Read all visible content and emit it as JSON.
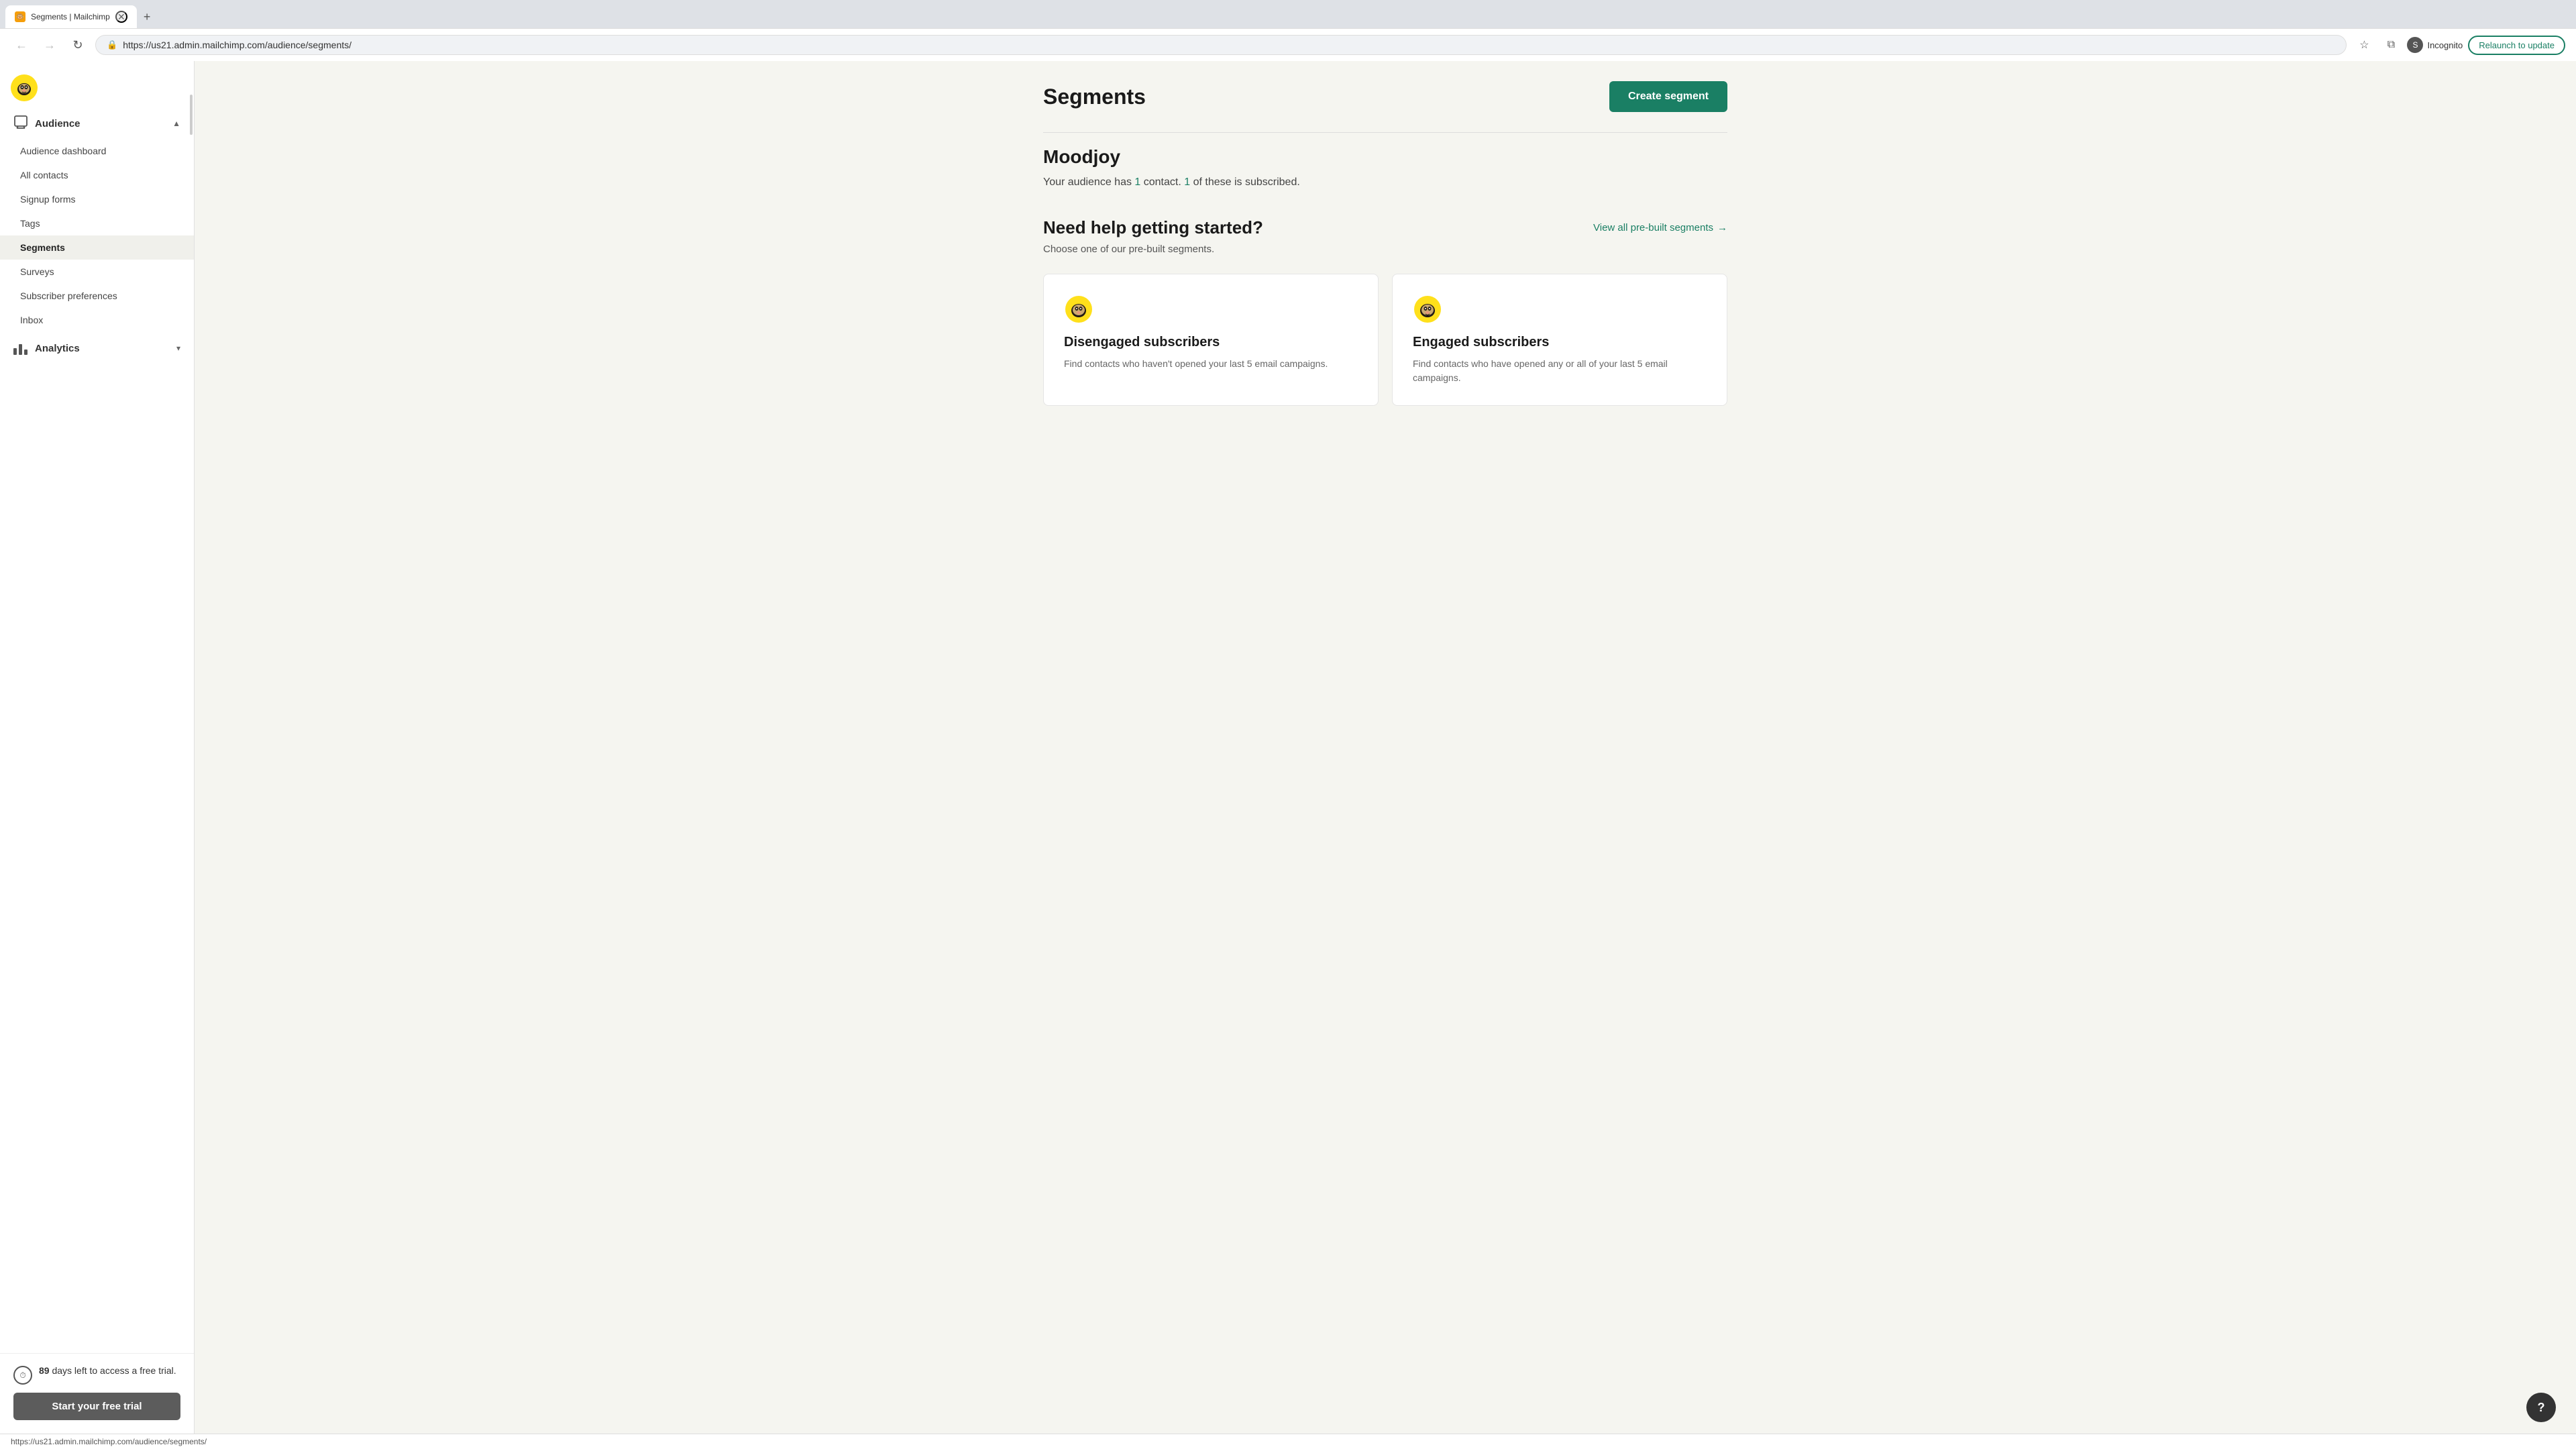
{
  "browser": {
    "tab_title": "Segments | Mailchimp",
    "favicon_emoji": "🐒",
    "url": "us21.admin.mailchimp.com/audience/segments/",
    "url_full": "https://us21.admin.mailchimp.com/audience/segments/",
    "incognito_label": "Incognito",
    "relaunch_label": "Relaunch to update"
  },
  "sidebar": {
    "section_audience": {
      "title": "Audience",
      "items": [
        {
          "label": "Audience dashboard",
          "active": false
        },
        {
          "label": "All contacts",
          "active": false
        },
        {
          "label": "Signup forms",
          "active": false
        },
        {
          "label": "Tags",
          "active": false
        },
        {
          "label": "Segments",
          "active": true
        },
        {
          "label": "Surveys",
          "active": false
        },
        {
          "label": "Subscriber preferences",
          "active": false
        },
        {
          "label": "Inbox",
          "active": false
        }
      ]
    },
    "section_analytics": {
      "title": "Analytics"
    }
  },
  "trial": {
    "days_left": "89",
    "message": " days left to access a free trial.",
    "cta_label": "Start your free trial"
  },
  "main": {
    "page_title": "Segments",
    "create_button_label": "Create segment",
    "audience_name": "Moodjoy",
    "audience_description_prefix": "Your audience has ",
    "contact_count": "1",
    "audience_description_middle": " contact. ",
    "subscribed_count": "1",
    "audience_description_suffix": " of these is subscribed.",
    "help_title": "Need help getting started?",
    "help_desc": "Choose one of our pre-built segments.",
    "view_all_label": "View all pre-built segments",
    "cards": [
      {
        "title": "Disengaged subscribers",
        "description": "Find contacts who haven't opened your last 5 email campaigns."
      },
      {
        "title": "Engaged subscribers",
        "description": "Find contacts who have opened any or all of your last 5 email campaigns."
      }
    ]
  },
  "status_bar": {
    "url": "https://us21.admin.mailchimp.com/audience/segments/"
  },
  "icons": {
    "back": "←",
    "forward": "→",
    "refresh": "↻",
    "search": "🔍",
    "bookmark": "☆",
    "extensions": "⧉",
    "close": "✕",
    "new_tab": "+",
    "chevron_down": "▾",
    "chevron_right": "›",
    "arrow_right": "→",
    "question": "?",
    "lock": "🔒",
    "clock": "⏱"
  }
}
